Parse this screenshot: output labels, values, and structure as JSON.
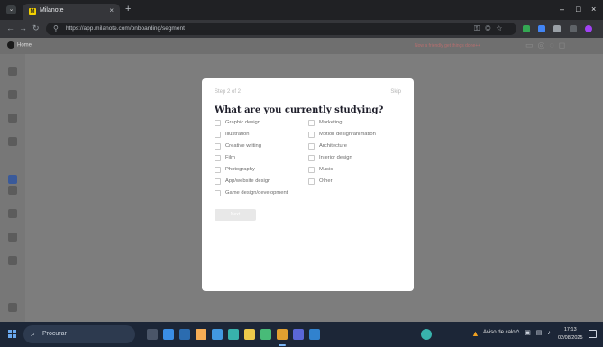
{
  "browser": {
    "tab_title": "Milanote",
    "tab_close": "×",
    "new_tab": "+",
    "url": "https://app.milanote.com/onboarding/segment",
    "win_min": "–",
    "win_max": "□",
    "win_close": "×"
  },
  "app": {
    "home_label": "Home",
    "top_notice": "Now a friendly get things done++"
  },
  "modal": {
    "step": "Step 2 of 2",
    "skip": "Skip",
    "question": "What are you currently studying?",
    "options_left": [
      "Graphic design",
      "Illustration",
      "Creative writing",
      "Film",
      "Photography",
      "App/website design",
      "Game design/development"
    ],
    "options_right": [
      "Marketing",
      "Motion design/animation",
      "Architecture",
      "Interior design",
      "Music",
      "Other"
    ],
    "next_button": "Next"
  },
  "taskbar": {
    "search_placeholder": "Procurar",
    "weather": "Aviso de calor",
    "time": "17:13",
    "date": "02/08/2025"
  },
  "colors": {
    "modal_bg": "#ffffff",
    "overlay": "#7d7d7d",
    "taskbar": "#1c2637",
    "question_text": "#1e1e2a"
  }
}
